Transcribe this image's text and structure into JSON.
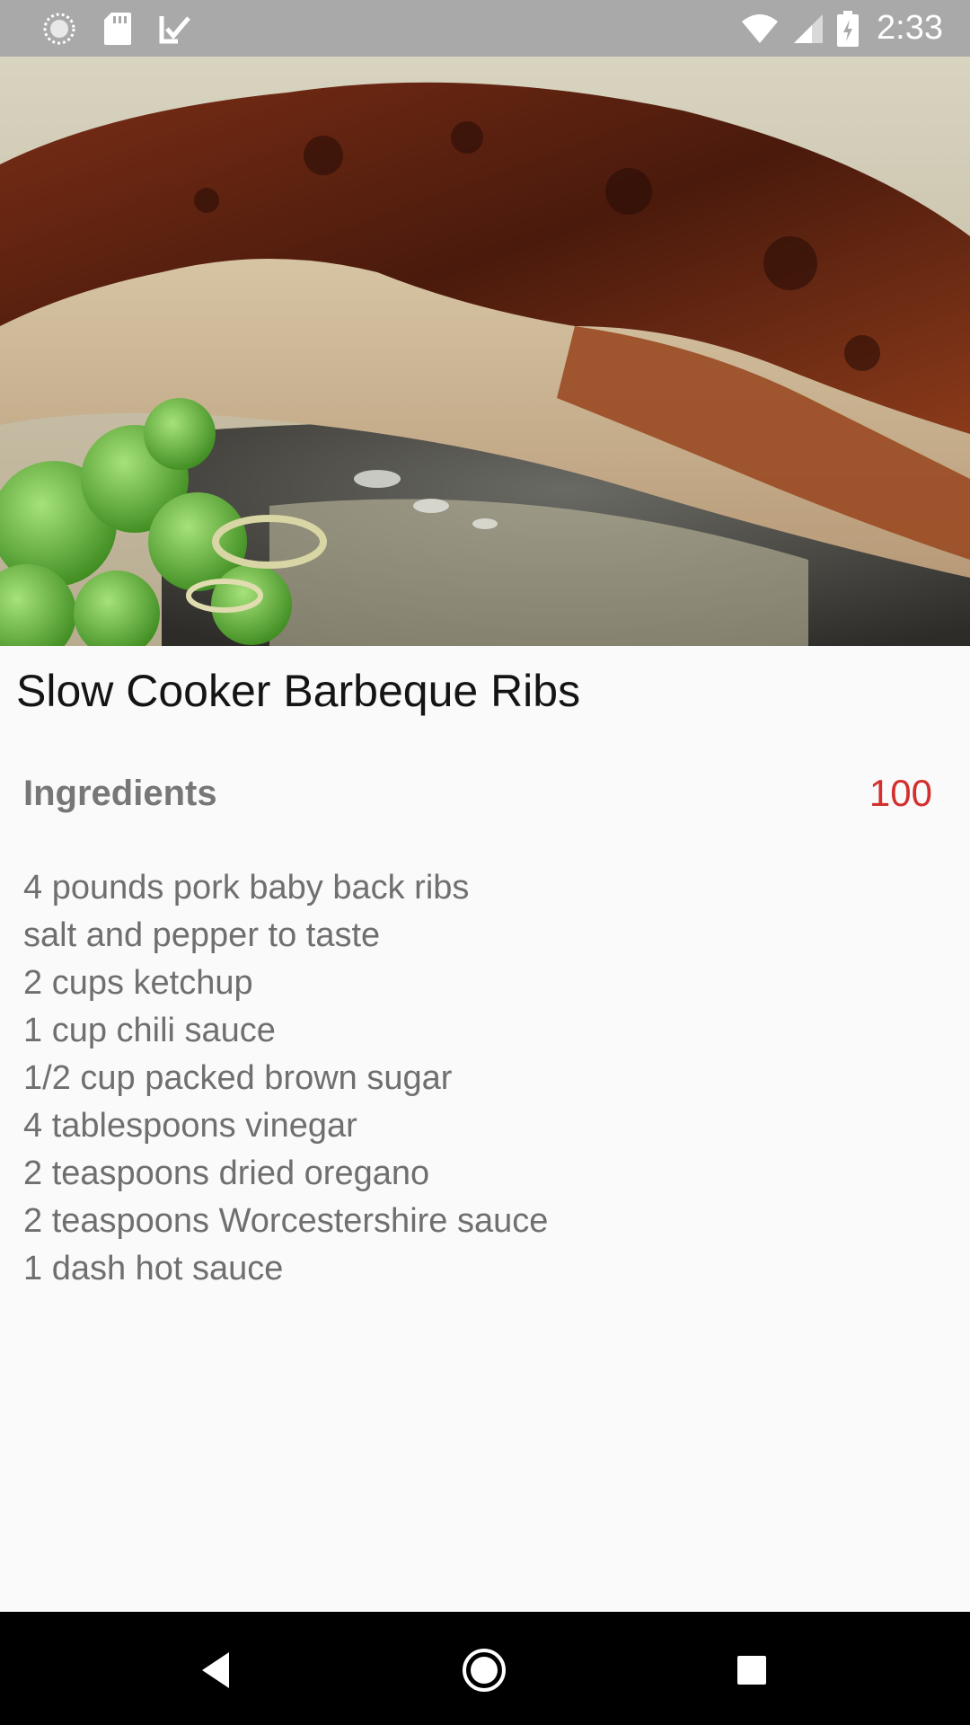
{
  "status_bar": {
    "time": "2:33",
    "left_icons": [
      "sync-icon",
      "sd-card-icon",
      "clipboard-check-icon"
    ],
    "right_icons": [
      "wifi-icon",
      "signal-icon",
      "battery-icon"
    ]
  },
  "recipe": {
    "title": "Slow Cooker Barbeque Ribs",
    "section_label": "Ingredients",
    "count": "100",
    "ingredients": [
      "4 pounds pork baby back ribs",
      "salt and pepper to taste",
      "2 cups ketchup",
      "1 cup chili sauce",
      "1/2 cup packed brown sugar",
      "4 tablespoons vinegar",
      "2 teaspoons dried oregano",
      "2 teaspoons Worcestershire sauce",
      "1 dash hot sauce"
    ]
  },
  "nav_bar": {
    "buttons": [
      "back-icon",
      "home-icon",
      "recents-icon"
    ]
  },
  "colors": {
    "status_bar": "#a9a9a9",
    "background": "#fafafa",
    "accent_count": "#d32f2f",
    "title_text": "#141414",
    "body_text": "#6f6f6f"
  }
}
